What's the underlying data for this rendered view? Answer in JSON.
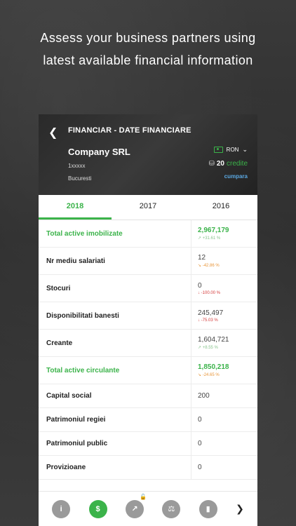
{
  "headline": {
    "line1": "Assess your business partners using",
    "line2": "latest available financial information"
  },
  "header": {
    "back_icon": "back-arrow-icon",
    "title": "FINANCIAR - DATE FINANCIARE",
    "company": "Company SRL",
    "cui": "1xxxxx",
    "city": "Bucuresti",
    "currency": "RON",
    "credits_num": "20",
    "credits_label": "credite",
    "buy_label": "cumpara"
  },
  "tabs": [
    "2018",
    "2017",
    "2016"
  ],
  "rows": [
    {
      "label": "Total active imobilizate",
      "value": "2,967,179",
      "change": "↗ +31.61 %"
    },
    {
      "label": "Nr mediu salariati",
      "value": "12",
      "change": "↘ -42.86 %"
    },
    {
      "label": "Stocuri",
      "value": "0",
      "change": "↓ -100.00 %"
    },
    {
      "label": "Disponibilitati banesti",
      "value": "245,497",
      "change": "↓ -75.03 %"
    },
    {
      "label": "Creante",
      "value": "1,604,721",
      "change": "↗ +8.55 %"
    },
    {
      "label": "Total active circulante",
      "value": "1,850,218",
      "change": "↘ -24.65 %"
    },
    {
      "label": "Capital social",
      "value": "200"
    },
    {
      "label": "Patrimoniul regiei",
      "value": "0"
    },
    {
      "label": "Patrimoniul public",
      "value": "0"
    },
    {
      "label": "Provizioane",
      "value": "0"
    }
  ],
  "bottom_nav": {
    "icons": [
      "info-icon",
      "money-icon",
      "chart-icon",
      "scales-icon",
      "bar-chart-icon"
    ],
    "next_icon": "chevron-right-icon"
  },
  "colors": {
    "accent": "#3bb34a",
    "down_orange": "#e8963a",
    "down_red": "#d43b3b",
    "up": "#8bc58f",
    "link": "#5aa7e0"
  }
}
